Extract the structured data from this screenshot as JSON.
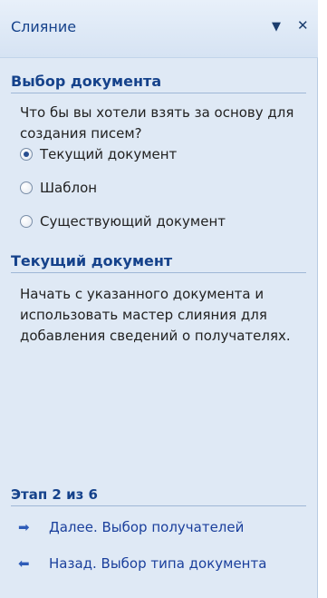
{
  "pane": {
    "title": "Слияние",
    "menu_icon": "triangle-down-icon",
    "close_icon": "close-icon"
  },
  "section1": {
    "heading": "Выбор документа",
    "question": "Что бы вы хотели взять за основу для создания писем?",
    "options": [
      {
        "label": "Текущий документ",
        "checked": true
      },
      {
        "label": "Шаблон",
        "checked": false
      },
      {
        "label": "Существующий документ",
        "checked": false
      }
    ]
  },
  "section2": {
    "heading": "Текущий документ",
    "description": "Начать с указанного документа и использовать мастер слияния для добавления сведений о получателях."
  },
  "footer": {
    "step": "Этап 2 из 6",
    "next": "Далее. Выбор получателей",
    "back": "Назад. Выбор типа документа",
    "next_icon": "arrow-right-icon",
    "back_icon": "arrow-left-icon"
  }
}
